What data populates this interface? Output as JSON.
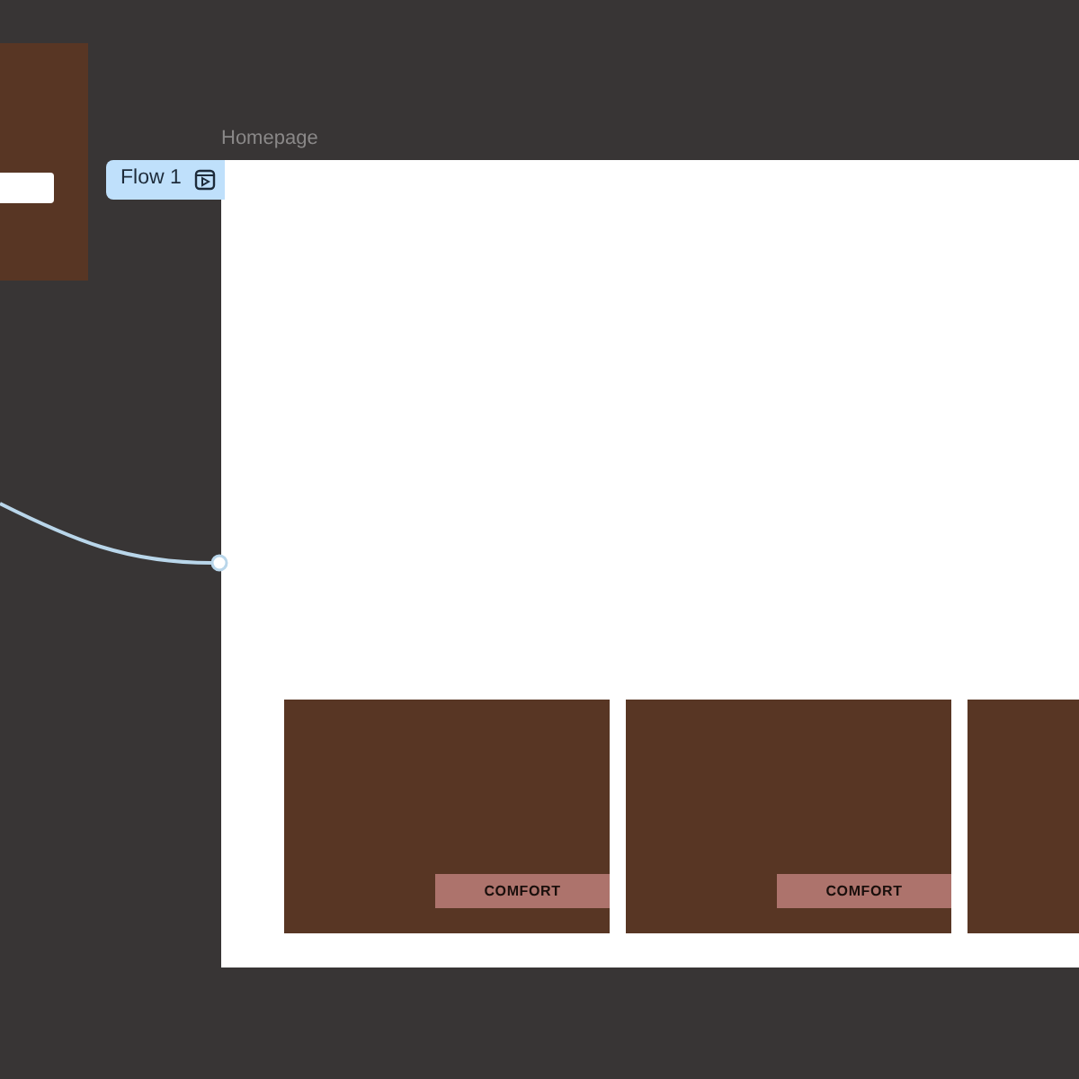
{
  "canvas": {
    "frames": [
      {
        "kind": "thumbnail"
      },
      {
        "kind": "page",
        "title": "Homepage",
        "flow": {
          "label": "Flow 1"
        },
        "cards": [
          {
            "kind": "labeled",
            "label": "COMFORT"
          },
          {
            "kind": "labeled",
            "label": "COMFORT"
          },
          {
            "kind": "plain"
          }
        ]
      }
    ]
  }
}
